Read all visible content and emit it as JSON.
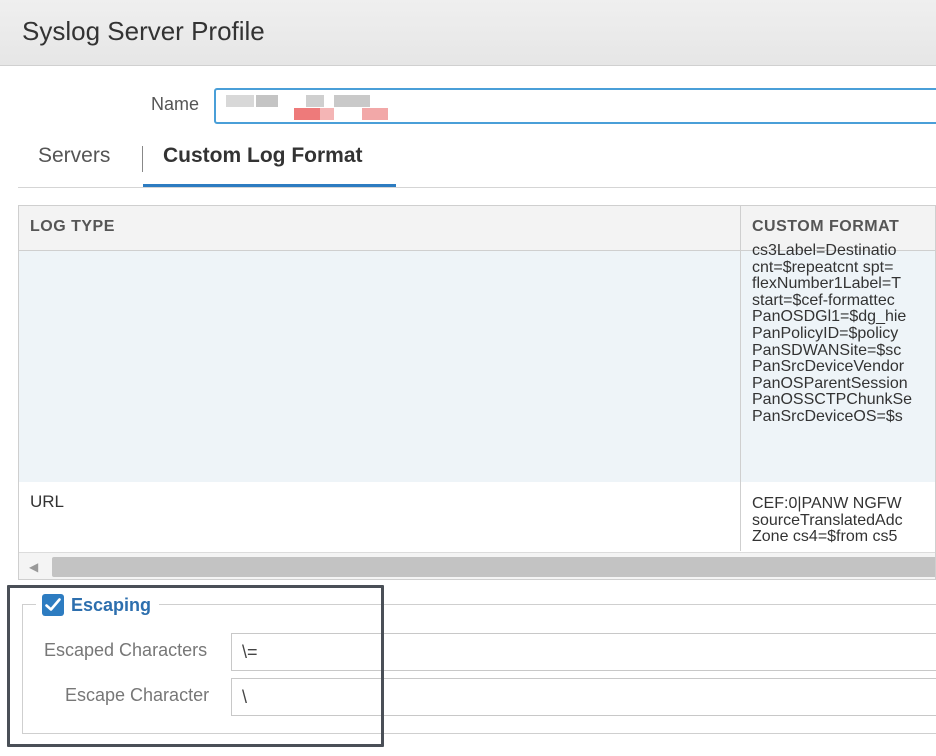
{
  "window": {
    "title": "Syslog Server Profile"
  },
  "name_field": {
    "label": "Name",
    "value": ""
  },
  "tabs": [
    {
      "label": "Servers",
      "active": false
    },
    {
      "label": "Custom Log Format",
      "active": true
    }
  ],
  "table": {
    "columns": [
      "LOG TYPE",
      "CUSTOM FORMAT"
    ],
    "rows": [
      {
        "log_type": "",
        "custom_format_lines": [
          "cs3Label=Destinatio",
          "cnt=$repeatcnt spt=",
          "flexNumber1Label=T",
          "start=$cef-formattec",
          "PanOSDGl1=$dg_hie",
          "PanPolicyID=$policy",
          "PanSDWANSite=$sc",
          "PanSrcDeviceVendor",
          "PanOSParentSession",
          "PanOSSCTPChunkSe",
          "PanSrcDeviceOS=$s"
        ]
      },
      {
        "log_type": "URL",
        "custom_format_lines": [
          "CEF:0|PANW NGFW",
          "sourceTranslatedAdc",
          "Zone cs4=$from cs5"
        ]
      }
    ],
    "scroll_left_icon": "chevron-left-icon"
  },
  "escaping": {
    "legend": "Escaping",
    "checked": true,
    "escaped_characters": {
      "label": "Escaped Characters",
      "value": "\\="
    },
    "escape_character": {
      "label": "Escape Character",
      "value": "\\"
    }
  },
  "colors": {
    "accent": "#2d7cc1",
    "input_focus": "#4a9fd8",
    "row_highlight": "#eef4f8",
    "annotation_box": "#4a4f57"
  }
}
